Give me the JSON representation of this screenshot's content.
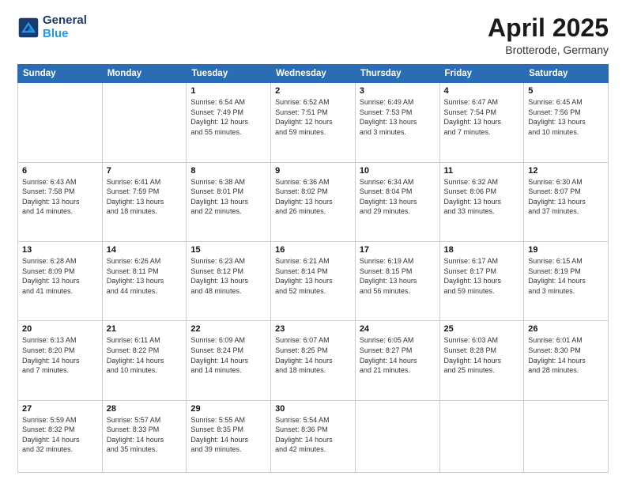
{
  "header": {
    "logo_line1": "General",
    "logo_line2": "Blue",
    "month": "April 2025",
    "location": "Brotterode, Germany"
  },
  "weekdays": [
    "Sunday",
    "Monday",
    "Tuesday",
    "Wednesday",
    "Thursday",
    "Friday",
    "Saturday"
  ],
  "weeks": [
    [
      {
        "day": "",
        "info": ""
      },
      {
        "day": "",
        "info": ""
      },
      {
        "day": "1",
        "info": "Sunrise: 6:54 AM\nSunset: 7:49 PM\nDaylight: 12 hours\nand 55 minutes."
      },
      {
        "day": "2",
        "info": "Sunrise: 6:52 AM\nSunset: 7:51 PM\nDaylight: 12 hours\nand 59 minutes."
      },
      {
        "day": "3",
        "info": "Sunrise: 6:49 AM\nSunset: 7:53 PM\nDaylight: 13 hours\nand 3 minutes."
      },
      {
        "day": "4",
        "info": "Sunrise: 6:47 AM\nSunset: 7:54 PM\nDaylight: 13 hours\nand 7 minutes."
      },
      {
        "day": "5",
        "info": "Sunrise: 6:45 AM\nSunset: 7:56 PM\nDaylight: 13 hours\nand 10 minutes."
      }
    ],
    [
      {
        "day": "6",
        "info": "Sunrise: 6:43 AM\nSunset: 7:58 PM\nDaylight: 13 hours\nand 14 minutes."
      },
      {
        "day": "7",
        "info": "Sunrise: 6:41 AM\nSunset: 7:59 PM\nDaylight: 13 hours\nand 18 minutes."
      },
      {
        "day": "8",
        "info": "Sunrise: 6:38 AM\nSunset: 8:01 PM\nDaylight: 13 hours\nand 22 minutes."
      },
      {
        "day": "9",
        "info": "Sunrise: 6:36 AM\nSunset: 8:02 PM\nDaylight: 13 hours\nand 26 minutes."
      },
      {
        "day": "10",
        "info": "Sunrise: 6:34 AM\nSunset: 8:04 PM\nDaylight: 13 hours\nand 29 minutes."
      },
      {
        "day": "11",
        "info": "Sunrise: 6:32 AM\nSunset: 8:06 PM\nDaylight: 13 hours\nand 33 minutes."
      },
      {
        "day": "12",
        "info": "Sunrise: 6:30 AM\nSunset: 8:07 PM\nDaylight: 13 hours\nand 37 minutes."
      }
    ],
    [
      {
        "day": "13",
        "info": "Sunrise: 6:28 AM\nSunset: 8:09 PM\nDaylight: 13 hours\nand 41 minutes."
      },
      {
        "day": "14",
        "info": "Sunrise: 6:26 AM\nSunset: 8:11 PM\nDaylight: 13 hours\nand 44 minutes."
      },
      {
        "day": "15",
        "info": "Sunrise: 6:23 AM\nSunset: 8:12 PM\nDaylight: 13 hours\nand 48 minutes."
      },
      {
        "day": "16",
        "info": "Sunrise: 6:21 AM\nSunset: 8:14 PM\nDaylight: 13 hours\nand 52 minutes."
      },
      {
        "day": "17",
        "info": "Sunrise: 6:19 AM\nSunset: 8:15 PM\nDaylight: 13 hours\nand 56 minutes."
      },
      {
        "day": "18",
        "info": "Sunrise: 6:17 AM\nSunset: 8:17 PM\nDaylight: 13 hours\nand 59 minutes."
      },
      {
        "day": "19",
        "info": "Sunrise: 6:15 AM\nSunset: 8:19 PM\nDaylight: 14 hours\nand 3 minutes."
      }
    ],
    [
      {
        "day": "20",
        "info": "Sunrise: 6:13 AM\nSunset: 8:20 PM\nDaylight: 14 hours\nand 7 minutes."
      },
      {
        "day": "21",
        "info": "Sunrise: 6:11 AM\nSunset: 8:22 PM\nDaylight: 14 hours\nand 10 minutes."
      },
      {
        "day": "22",
        "info": "Sunrise: 6:09 AM\nSunset: 8:24 PM\nDaylight: 14 hours\nand 14 minutes."
      },
      {
        "day": "23",
        "info": "Sunrise: 6:07 AM\nSunset: 8:25 PM\nDaylight: 14 hours\nand 18 minutes."
      },
      {
        "day": "24",
        "info": "Sunrise: 6:05 AM\nSunset: 8:27 PM\nDaylight: 14 hours\nand 21 minutes."
      },
      {
        "day": "25",
        "info": "Sunrise: 6:03 AM\nSunset: 8:28 PM\nDaylight: 14 hours\nand 25 minutes."
      },
      {
        "day": "26",
        "info": "Sunrise: 6:01 AM\nSunset: 8:30 PM\nDaylight: 14 hours\nand 28 minutes."
      }
    ],
    [
      {
        "day": "27",
        "info": "Sunrise: 5:59 AM\nSunset: 8:32 PM\nDaylight: 14 hours\nand 32 minutes."
      },
      {
        "day": "28",
        "info": "Sunrise: 5:57 AM\nSunset: 8:33 PM\nDaylight: 14 hours\nand 35 minutes."
      },
      {
        "day": "29",
        "info": "Sunrise: 5:55 AM\nSunset: 8:35 PM\nDaylight: 14 hours\nand 39 minutes."
      },
      {
        "day": "30",
        "info": "Sunrise: 5:54 AM\nSunset: 8:36 PM\nDaylight: 14 hours\nand 42 minutes."
      },
      {
        "day": "",
        "info": ""
      },
      {
        "day": "",
        "info": ""
      },
      {
        "day": "",
        "info": ""
      }
    ]
  ]
}
